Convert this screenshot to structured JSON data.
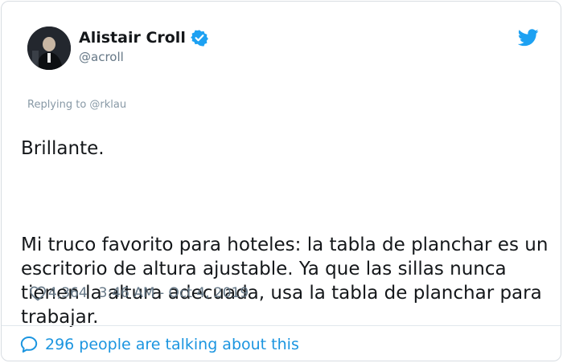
{
  "author": {
    "name": "Alistair Croll",
    "handle": "@acroll",
    "verified": true,
    "avatar_icon": "avatar-photo"
  },
  "brand": {
    "icon": "twitter-bird-icon",
    "color": "#1da1f2"
  },
  "reply": {
    "label": "Replying to @rklau"
  },
  "tweet": {
    "line1": "Brillante.",
    "paragraph2": "Mi truco favorito para hoteles: la tabla de planchar es un escritorio de altura ajustable. Ya que las sillas nunca tienen la altura adecuada, usa la tabla de planchar para trabajar."
  },
  "meta": {
    "likes": "4,364",
    "timestamp": "3:46 AM - Oct 4, 2019"
  },
  "footer": {
    "talking_label": "296 people are talking about this"
  },
  "colors": {
    "accent": "#1b95e0",
    "text": "#14171a",
    "muted": "#657786"
  }
}
